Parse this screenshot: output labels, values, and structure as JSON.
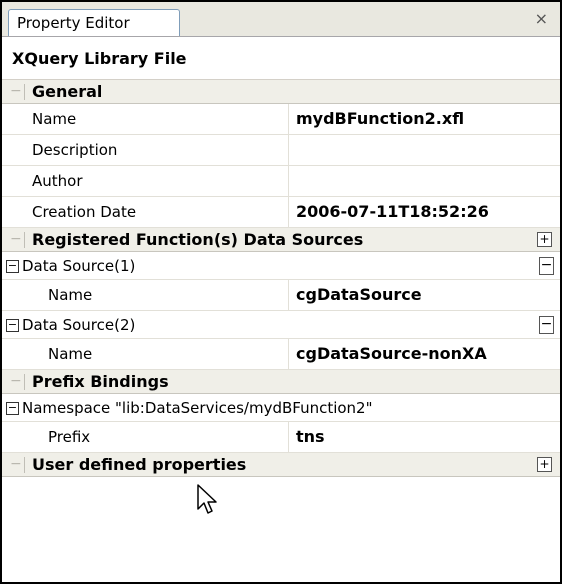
{
  "panel": {
    "tab_title": "Property Editor",
    "close_glyph": "×",
    "title": "XQuery Library File"
  },
  "sections": {
    "general": {
      "label": "General",
      "rows": [
        {
          "label": "Name",
          "value": "mydBFunction2.xfl"
        },
        {
          "label": "Description",
          "value": ""
        },
        {
          "label": "Author",
          "value": ""
        },
        {
          "label": "Creation Date",
          "value": "2006-07-11T18:52:26"
        }
      ]
    },
    "registered": {
      "label": "Registered Function(s) Data Sources",
      "expand_glyph": "+",
      "groups": [
        {
          "label": "Data Source(1)",
          "collapse_glyph": "−",
          "row_label": "Name",
          "row_value": "cgDataSource"
        },
        {
          "label": "Data Source(2)",
          "collapse_glyph": "−",
          "row_label": "Name",
          "row_value": "cgDataSource-nonXA"
        }
      ]
    },
    "prefix": {
      "label": "Prefix Bindings",
      "group_label": "Namespace \"lib:DataServices/mydBFunction2\"",
      "row_label": "Prefix",
      "row_value": "tns"
    },
    "user": {
      "label": "User defined properties",
      "expand_glyph": "+"
    }
  },
  "icons": {
    "collapse_section": "−",
    "tree_toggle": "−"
  }
}
